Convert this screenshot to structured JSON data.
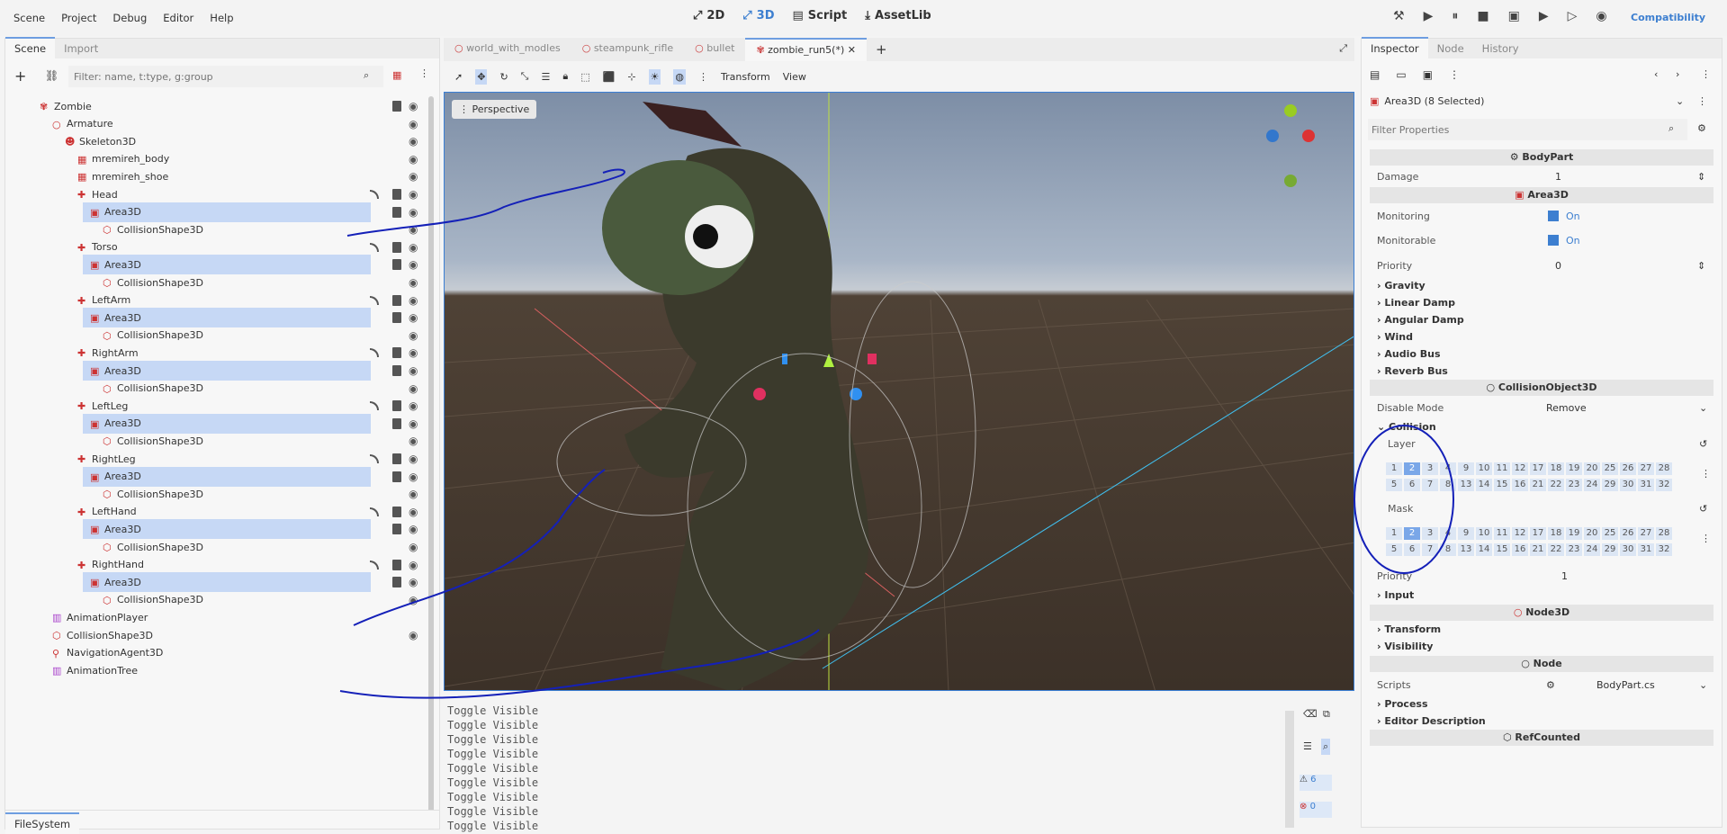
{
  "menu": [
    "Scene",
    "Project",
    "Debug",
    "Editor",
    "Help"
  ],
  "modes": {
    "twod": "2D",
    "threed": "3D",
    "script": "Script",
    "assetlib": "AssetLib"
  },
  "compat": "Compatibility",
  "scene_tabs": {
    "scene": "Scene",
    "import": "Import"
  },
  "filter": {
    "placeholder": "Filter: name, t:type, g:group"
  },
  "tree": [
    {
      "label": "Zombie"
    },
    {
      "label": "Armature"
    },
    {
      "label": "Skeleton3D"
    },
    {
      "label": "mremireh_body"
    },
    {
      "label": "mremireh_shoe"
    },
    {
      "label": "Head"
    },
    {
      "label": "Area3D"
    },
    {
      "label": "CollisionShape3D"
    },
    {
      "label": "Torso"
    },
    {
      "label": "Area3D"
    },
    {
      "label": "CollisionShape3D"
    },
    {
      "label": "LeftArm"
    },
    {
      "label": "Area3D"
    },
    {
      "label": "CollisionShape3D"
    },
    {
      "label": "RightArm"
    },
    {
      "label": "Area3D"
    },
    {
      "label": "CollisionShape3D"
    },
    {
      "label": "LeftLeg"
    },
    {
      "label": "Area3D"
    },
    {
      "label": "CollisionShape3D"
    },
    {
      "label": "RightLeg"
    },
    {
      "label": "Area3D"
    },
    {
      "label": "CollisionShape3D"
    },
    {
      "label": "LeftHand"
    },
    {
      "label": "Area3D"
    },
    {
      "label": "CollisionShape3D"
    },
    {
      "label": "RightHand"
    },
    {
      "label": "Area3D"
    },
    {
      "label": "CollisionShape3D"
    },
    {
      "label": "AnimationPlayer"
    },
    {
      "label": "CollisionShape3D"
    },
    {
      "label": "NavigationAgent3D"
    },
    {
      "label": "AnimationTree"
    }
  ],
  "filesystem": "FileSystem",
  "editor_tabs": [
    "world_with_modles",
    "steampunk_rifle",
    "bullet",
    "zombie_run5(*)"
  ],
  "toolbar": {
    "transform": "Transform",
    "view": "View"
  },
  "viewport": {
    "perspective": "Perspective"
  },
  "console": [
    "Toggle Visible",
    "Toggle Visible",
    "Toggle Visible",
    "Toggle Visible",
    "Toggle Visible",
    "Toggle Visible",
    "Toggle Visible",
    "Toggle Visible",
    "Toggle Visible"
  ],
  "console_counts": {
    "warnings": "6",
    "errors": "0"
  },
  "inspector": {
    "tabs": [
      "Inspector",
      "Node",
      "History"
    ],
    "object": "Area3D (8 Selected)",
    "filter_placeholder": "Filter Properties",
    "bodypart": "BodyPart",
    "damage_label": "Damage",
    "damage": "1",
    "area3d": "Area3D",
    "monitoring": "Monitoring",
    "monitoring_val": "On",
    "monitorable": "Monitorable",
    "monitorable_val": "On",
    "priority": "Priority",
    "priority_val": "0",
    "groups1": [
      "Gravity",
      "Linear Damp",
      "Angular Damp",
      "Wind",
      "Audio Bus",
      "Reverb Bus"
    ],
    "collisionobject": "CollisionObject3D",
    "disable_mode": "Disable Mode",
    "disable_val": "Remove",
    "collision": "Collision",
    "layer": "Layer",
    "mask": "Mask",
    "priority2_val": "1",
    "input": "Input",
    "node3d": "Node3D",
    "groups2": [
      "Transform",
      "Visibility"
    ],
    "node": "Node",
    "scripts": "Scripts",
    "scripts_val": "BodyPart.cs",
    "groups3": [
      "Process",
      "Editor Description"
    ],
    "refcounted": "RefCounted"
  },
  "layer_cells": [
    [
      "1",
      "2",
      "3",
      "4"
    ],
    [
      "5",
      "6",
      "7",
      "8"
    ],
    [
      "9",
      "10",
      "11",
      "12"
    ],
    [
      "13",
      "14",
      "15",
      "16"
    ],
    [
      "17",
      "18",
      "19",
      "20"
    ],
    [
      "21",
      "22",
      "23",
      "24"
    ],
    [
      "25",
      "26",
      "27",
      "28"
    ],
    [
      "29",
      "30",
      "31",
      "32"
    ]
  ]
}
